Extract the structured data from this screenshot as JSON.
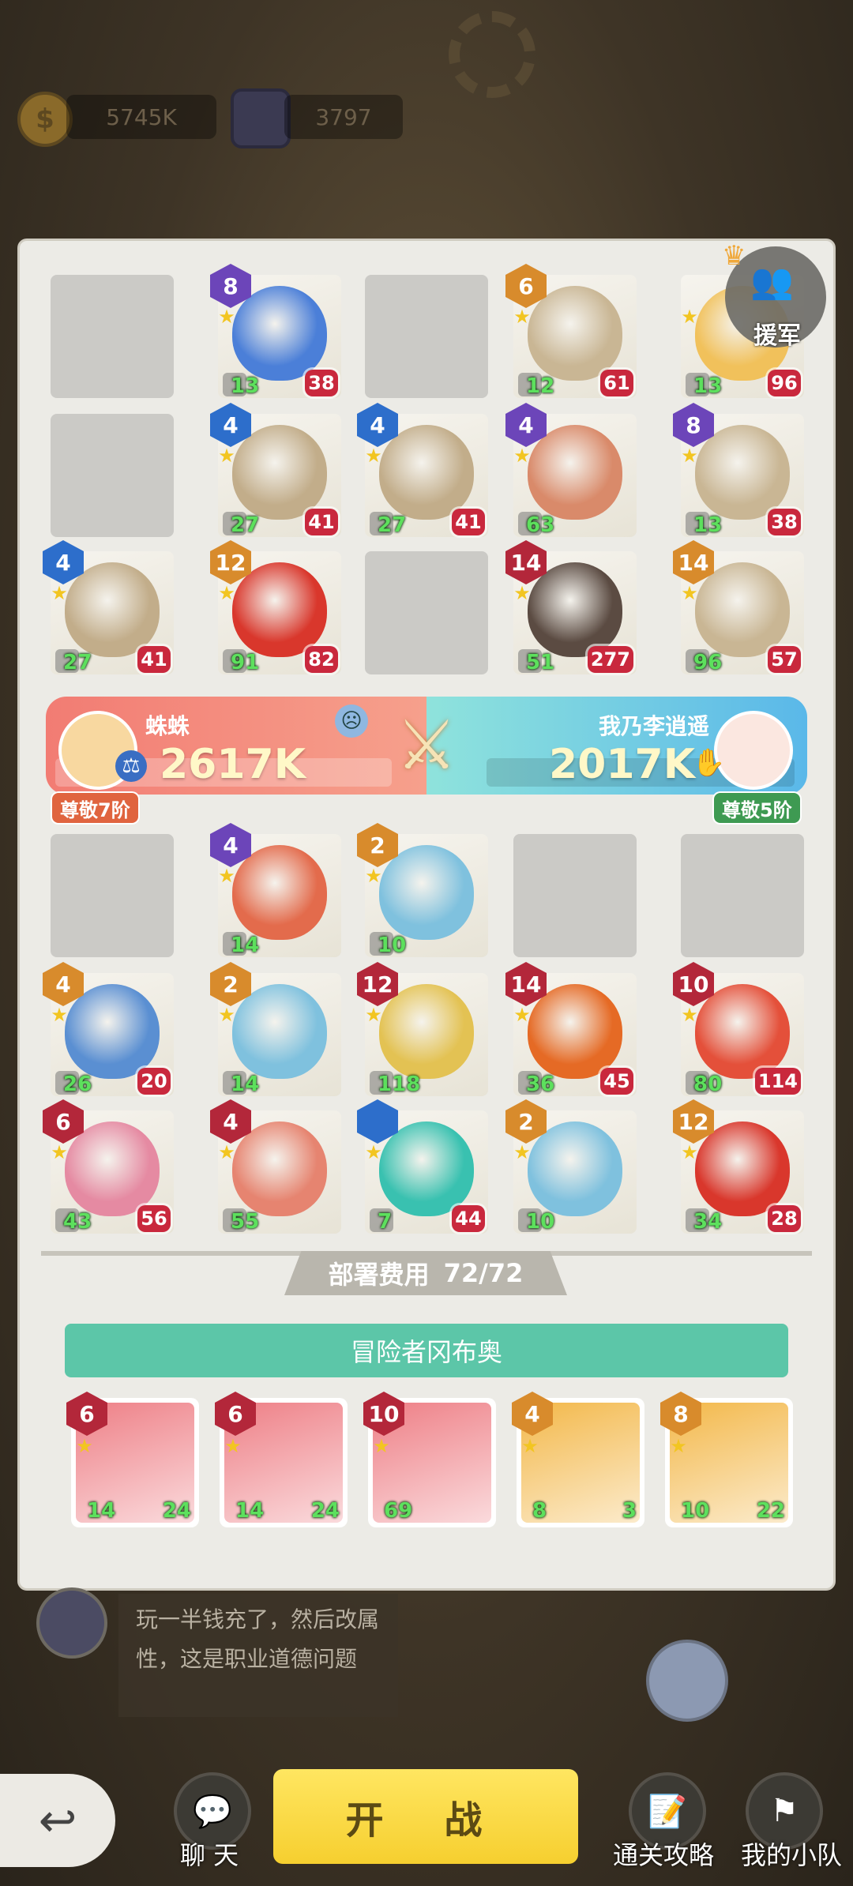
{
  "resources": {
    "coins": "5745K",
    "gems": "3797"
  },
  "reinforce": {
    "label": "援军"
  },
  "enemy_grid": [
    [
      null,
      {
        "level": "8",
        "rank": "purple",
        "lv": "13",
        "pw": "38",
        "art": "#4b7fd8"
      },
      null,
      {
        "level": "6",
        "rank": "orange",
        "lv": "12",
        "pw": "61",
        "art": "#c9b694"
      },
      {
        "level": "",
        "rank": "none",
        "lv": "13",
        "pw": "96",
        "art": "#f1c15b"
      }
    ],
    [
      null,
      {
        "level": "4",
        "rank": "blue",
        "lv": "27",
        "pw": "41",
        "art": "#c2ad8a"
      },
      {
        "level": "4",
        "rank": "blue",
        "lv": "27",
        "pw": "41",
        "art": "#c2ad8a"
      },
      {
        "level": "4",
        "rank": "purple",
        "lv": "63",
        "pw": "",
        "art": "#d98a6a"
      },
      {
        "level": "8",
        "rank": "purple",
        "lv": "13",
        "pw": "38",
        "art": "#c9b694"
      }
    ],
    [
      {
        "level": "4",
        "rank": "blue",
        "lv": "27",
        "pw": "41",
        "art": "#c2ad8a"
      },
      {
        "level": "12",
        "rank": "orange",
        "lv": "91",
        "pw": "82",
        "art": "#d9372c"
      },
      null,
      {
        "level": "14",
        "rank": "red",
        "lv": "51",
        "pw": "277",
        "art": "#5b4b42"
      },
      {
        "level": "14",
        "rank": "orange",
        "lv": "96",
        "pw": "57",
        "art": "#c9b694"
      }
    ]
  ],
  "versus": {
    "left_name": "蛛蛛",
    "left_score": "2617K",
    "left_rank": "尊敬7阶",
    "right_name": "我乃李逍遥",
    "right_score": "2017K",
    "right_rank": "尊敬5阶"
  },
  "player_grid": [
    [
      null,
      {
        "level": "4",
        "rank": "purple",
        "lv": "14",
        "pw": "",
        "art": "#e36b4c"
      },
      {
        "level": "2",
        "rank": "orange",
        "lv": "10",
        "pw": "",
        "art": "#7fc1de"
      },
      null,
      null
    ],
    [
      {
        "level": "4",
        "rank": "orange",
        "lv": "26",
        "pw": "20",
        "art": "#5a8fd2"
      },
      {
        "level": "2",
        "rank": "orange",
        "lv": "14",
        "pw": "",
        "art": "#7fc1de"
      },
      {
        "level": "12",
        "rank": "red",
        "lv": "118",
        "pw": "",
        "art": "#e3c253"
      },
      {
        "level": "14",
        "rank": "red",
        "lv": "36",
        "pw": "45",
        "art": "#e56a25"
      },
      {
        "level": "10",
        "rank": "red",
        "lv": "80",
        "pw": "114",
        "art": "#e4503a"
      }
    ],
    [
      {
        "level": "6",
        "rank": "red",
        "lv": "43",
        "pw": "56",
        "art": "#e58aa2"
      },
      {
        "level": "4",
        "rank": "red",
        "lv": "55",
        "pw": "",
        "art": "#e68470"
      },
      {
        "level": "",
        "rank": "blue",
        "lv": "7",
        "pw": "44",
        "art": "#39c1b0"
      },
      {
        "level": "2",
        "rank": "orange",
        "lv": "10",
        "pw": "",
        "art": "#7fc1de"
      },
      {
        "level": "12",
        "rank": "orange",
        "lv": "34",
        "pw": "28",
        "art": "#d9372c"
      }
    ]
  ],
  "deploy": {
    "label": "部署费用",
    "value": "72/72"
  },
  "adventurer": {
    "label": "冒险者冈布奥"
  },
  "bench": [
    {
      "level": "6",
      "rank": "red",
      "lv": "14",
      "pw": "24",
      "bg": "#ee7f86"
    },
    {
      "level": "6",
      "rank": "red",
      "lv": "14",
      "pw": "24",
      "bg": "#ee7f86"
    },
    {
      "level": "10",
      "rank": "red",
      "lv": "69",
      "pw": "",
      "bg": "#ee7f86"
    },
    {
      "level": "4",
      "rank": "orange",
      "lv": "8",
      "pw": "3",
      "bg": "#f3b84a"
    },
    {
      "level": "8",
      "rank": "orange",
      "lv": "10",
      "pw": "22",
      "bg": "#f3b84a"
    }
  ],
  "chat": {
    "text": "玩一半钱充了，然后改属性，这是职业道德问题"
  },
  "bottom": {
    "start_label": "开 战",
    "chat_label": "聊 天",
    "guide_label": "通关攻略",
    "team_label": "我的小队"
  }
}
